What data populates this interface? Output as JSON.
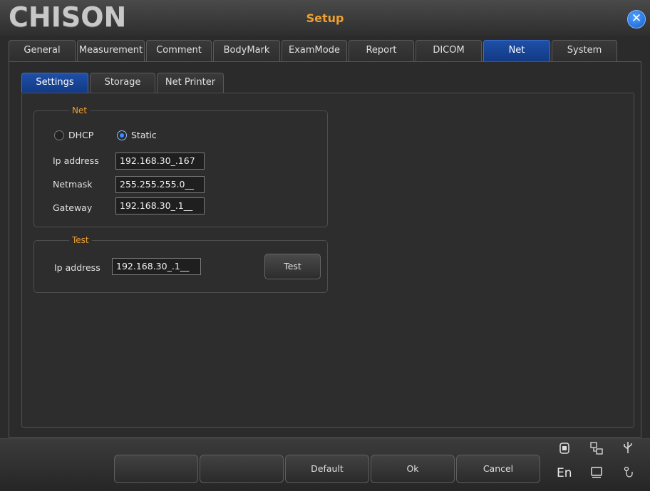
{
  "header": {
    "logo": "CHISON",
    "title": "Setup",
    "close_glyph": "✕"
  },
  "tabs": [
    {
      "label": "General",
      "active": false
    },
    {
      "label": "Measurement",
      "active": false
    },
    {
      "label": "Comment",
      "active": false
    },
    {
      "label": "BodyMark",
      "active": false
    },
    {
      "label": "ExamMode",
      "active": false
    },
    {
      "label": "Report",
      "active": false
    },
    {
      "label": "DICOM",
      "active": false
    },
    {
      "label": "Net",
      "active": true
    },
    {
      "label": "System",
      "active": false
    }
  ],
  "subtabs": [
    {
      "label": "Settings",
      "active": true
    },
    {
      "label": "Storage",
      "active": false
    },
    {
      "label": "Net Printer",
      "active": false
    }
  ],
  "net_group": {
    "legend": "Net",
    "mode_options": [
      {
        "label": "DHCP",
        "selected": false
      },
      {
        "label": "Static",
        "selected": true
      }
    ],
    "fields": [
      {
        "label": "Ip address",
        "value": "192.168.30_.167"
      },
      {
        "label": "Netmask",
        "value": "255.255.255.0__"
      },
      {
        "label": "Gateway",
        "value": "192.168.30_.1__"
      }
    ]
  },
  "test_group": {
    "legend": "Test",
    "ip_label": "Ip address",
    "ip_value": "192.168.30_.1__",
    "test_button": "Test"
  },
  "bottom_buttons": [
    "",
    "",
    "Default",
    "Ok",
    "Cancel"
  ],
  "system_tray": {
    "language": "En",
    "icons": [
      "disk-icon",
      "network-icon",
      "usb-icon",
      "display-icon",
      "probe-icon"
    ]
  },
  "colors": {
    "accent_orange": "#f0a030",
    "active_tab_blue": "#1f4fa8",
    "close_blue": "#1560d0"
  }
}
